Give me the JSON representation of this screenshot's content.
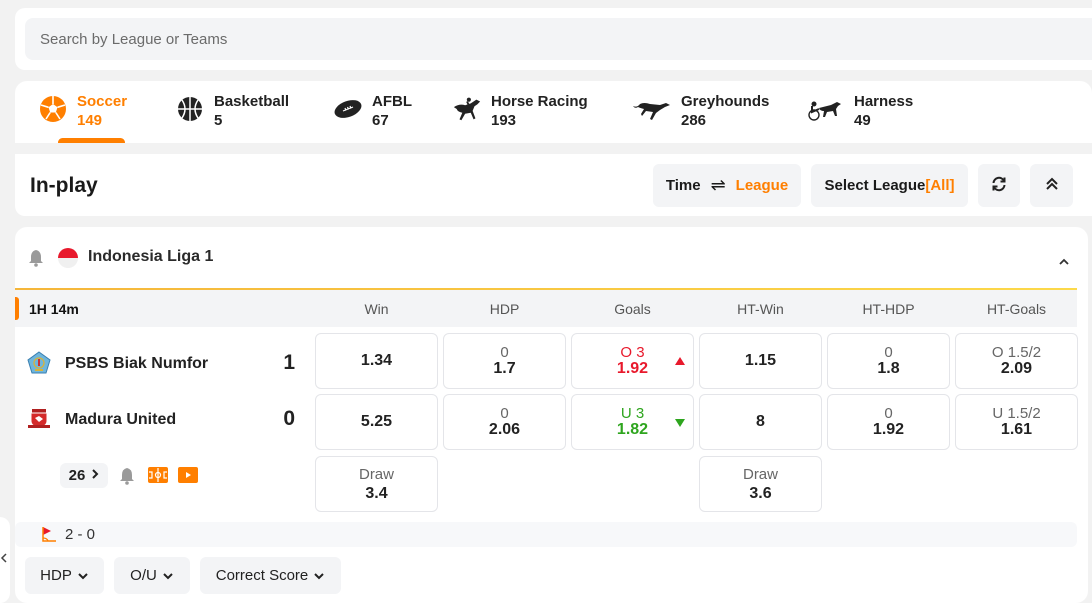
{
  "search": {
    "placeholder": "Search by League or Teams"
  },
  "sports": [
    {
      "name": "Soccer",
      "count": "149",
      "icon": "soccer-ball-icon",
      "active": true
    },
    {
      "name": "Basketball",
      "count": "5",
      "icon": "basketball-icon"
    },
    {
      "name": "AFBL",
      "count": "67",
      "icon": "american-football-icon"
    },
    {
      "name": "Horse Racing",
      "count": "193",
      "icon": "horse-racing-icon"
    },
    {
      "name": "Greyhounds",
      "count": "286",
      "icon": "greyhound-icon"
    },
    {
      "name": "Harness",
      "count": "49",
      "icon": "harness-racing-icon"
    }
  ],
  "inplay": {
    "title": "In-play",
    "sort_time": "Time",
    "sort_league": "League",
    "select_league_label": "Select League",
    "select_league_value": "[All]"
  },
  "colors": {
    "accent": "#ff7f00",
    "up": "#e8192c",
    "down": "#2ea51e"
  },
  "league": {
    "name": "Indonesia Liga 1",
    "match_time": "1H 14m",
    "columns": [
      "Win",
      "HDP",
      "Goals",
      "HT-Win",
      "HT-HDP",
      "HT-Goals"
    ],
    "home": {
      "name": "PSBS Biak Numfor",
      "score": "1",
      "win": "1.34",
      "hdp_line": "0",
      "hdp_price": "1.7",
      "goals_line": "O 3",
      "goals_price": "1.92",
      "goals_trend": "up",
      "ht_win": "1.15",
      "ht_hdp_line": "0",
      "ht_hdp_price": "1.8",
      "ht_goals_line": "O 1.5/2",
      "ht_goals_price": "2.09"
    },
    "away": {
      "name": "Madura United",
      "score": "0",
      "win": "5.25",
      "hdp_line": "0",
      "hdp_price": "2.06",
      "goals_line": "U 3",
      "goals_price": "1.82",
      "goals_trend": "down",
      "ht_win": "8",
      "ht_hdp_line": "0",
      "ht_hdp_price": "1.92",
      "ht_goals_line": "U 1.5/2",
      "ht_goals_price": "1.61"
    },
    "draw": {
      "label": "Draw",
      "win": "3.4",
      "ht_win": "3.6"
    },
    "more_markets": "26",
    "corners": "2 - 0",
    "market_buttons": [
      "HDP",
      "O/U",
      "Correct Score"
    ]
  }
}
